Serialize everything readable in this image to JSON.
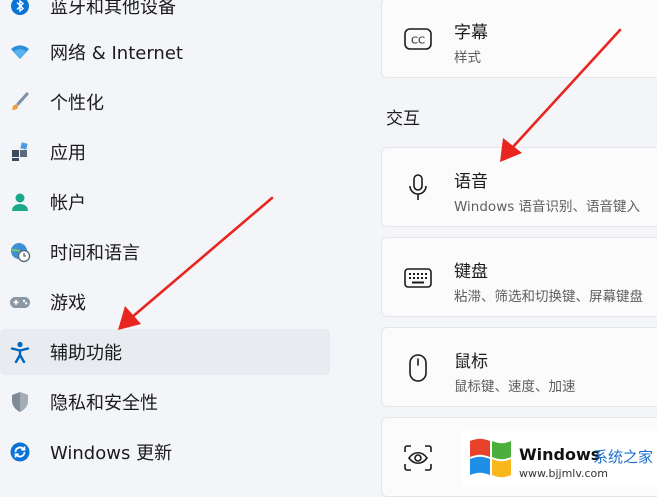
{
  "sidebar": {
    "items": [
      {
        "label": "蓝牙和其他设备",
        "icon": "bluetooth-icon"
      },
      {
        "label": "网络 & Internet",
        "icon": "wifi-icon"
      },
      {
        "label": "个性化",
        "icon": "brush-icon"
      },
      {
        "label": "应用",
        "icon": "apps-icon"
      },
      {
        "label": "帐户",
        "icon": "account-icon"
      },
      {
        "label": "时间和语言",
        "icon": "globe-clock-icon"
      },
      {
        "label": "游戏",
        "icon": "gamepad-icon"
      },
      {
        "label": "辅助功能",
        "icon": "accessibility-icon",
        "selected": true
      },
      {
        "label": "隐私和安全性",
        "icon": "shield-icon"
      },
      {
        "label": "Windows 更新",
        "icon": "windows-update-icon"
      }
    ]
  },
  "main": {
    "section_header": "交互",
    "cards": [
      {
        "title": "字幕",
        "subtitle": "样式",
        "icon": "captions-icon"
      },
      {
        "title": "语音",
        "subtitle": "Windows 语音识别、语音键入",
        "icon": "microphone-icon"
      },
      {
        "title": "键盘",
        "subtitle": "粘滞、筛选和切换键、屏幕键盘",
        "icon": "keyboard-icon"
      },
      {
        "title": "鼠标",
        "subtitle": "鼠标键、速度、加速",
        "icon": "mouse-icon"
      },
      {
        "title": "",
        "subtitle": "",
        "icon": "eye-control-icon"
      }
    ]
  },
  "watermark": {
    "title": "Windows",
    "title2": "系统之家",
    "url": "www.bjjmlv.com"
  },
  "colors": {
    "accent": "#0067c0",
    "arrow": "#e8251f",
    "selected_bg": "#e8ebef"
  }
}
